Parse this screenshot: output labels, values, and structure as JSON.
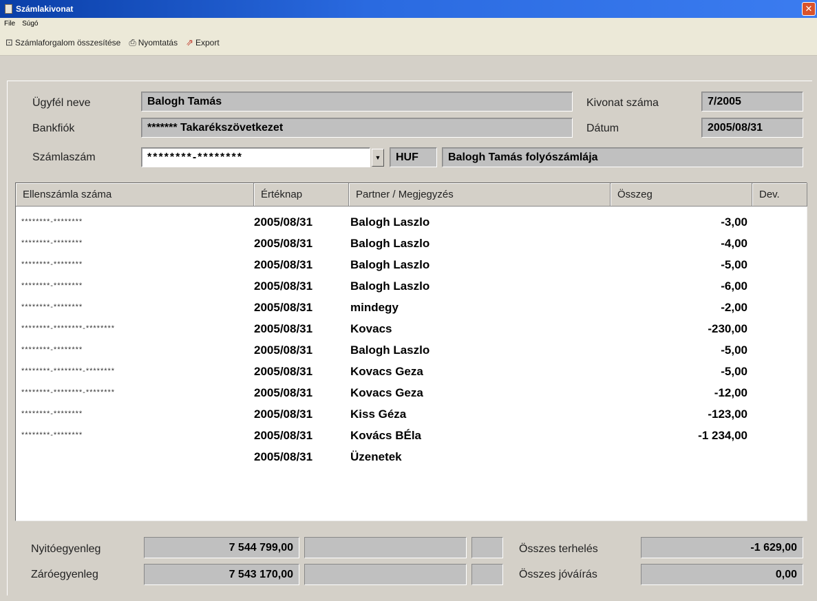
{
  "window": {
    "title": "Számlakivonat",
    "close": "✕"
  },
  "menu": [
    "File",
    "Súgó"
  ],
  "toolbar": {
    "summary": "Számlaforgalom összesítése",
    "print": "Nyomtatás",
    "export": "Export"
  },
  "header": {
    "customer_label": "Ügyfél neve",
    "customer_value": "Balogh Tamás",
    "branch_label": "Bankfiók",
    "branch_value": "******* Takarékszövetkezet",
    "account_label": "Számlaszám",
    "account_value": "********-********",
    "currency": "HUF",
    "account_name": "Balogh Tamás folyószámlája",
    "statement_no_label": "Kivonat száma",
    "statement_no_value": "7/2005",
    "date_label": "Dátum",
    "date_value": "2005/08/31"
  },
  "table": {
    "columns": [
      "Ellenszámla száma",
      "Értéknap",
      "Partner / Megjegyzés",
      "Összeg",
      "Dev."
    ],
    "rows": [
      {
        "account": "********-********",
        "date": "2005/08/31",
        "partner": "Balogh Laszlo",
        "amount": "-3,00"
      },
      {
        "account": "********-********",
        "date": "2005/08/31",
        "partner": "Balogh Laszlo",
        "amount": "-4,00"
      },
      {
        "account": "********-********",
        "date": "2005/08/31",
        "partner": "Balogh Laszlo",
        "amount": "-5,00"
      },
      {
        "account": "********-********",
        "date": "2005/08/31",
        "partner": "Balogh Laszlo",
        "amount": "-6,00"
      },
      {
        "account": "********-********",
        "date": "2005/08/31",
        "partner": "mindegy",
        "amount": "-2,00"
      },
      {
        "account": "********-********-********",
        "date": "2005/08/31",
        "partner": "Kovacs",
        "amount": "-230,00"
      },
      {
        "account": "********-********",
        "date": "2005/08/31",
        "partner": "Balogh Laszlo",
        "amount": "-5,00"
      },
      {
        "account": "********-********-********",
        "date": "2005/08/31",
        "partner": "Kovacs Geza",
        "amount": "-5,00"
      },
      {
        "account": "********-********-********",
        "date": "2005/08/31",
        "partner": "Kovacs Geza",
        "amount": "-12,00"
      },
      {
        "account": "********-********",
        "date": "2005/08/31",
        "partner": "Kiss Géza",
        "amount": "-123,00"
      },
      {
        "account": "********-********",
        "date": "2005/08/31",
        "partner": "Kovács BÉla",
        "amount": "-1 234,00"
      },
      {
        "account": "",
        "date": "2005/08/31",
        "partner": "Üzenetek",
        "amount": ""
      }
    ]
  },
  "summary": {
    "opening_label": "Nyitóegyenleg",
    "opening_value": "7 544 799,00",
    "closing_label": "Záróegyenleg",
    "closing_value": "7 543 170,00",
    "total_debit_label": "Összes terhelés",
    "total_debit_value": "-1 629,00",
    "total_credit_label": "Összes jóváírás",
    "total_credit_value": "0,00"
  }
}
